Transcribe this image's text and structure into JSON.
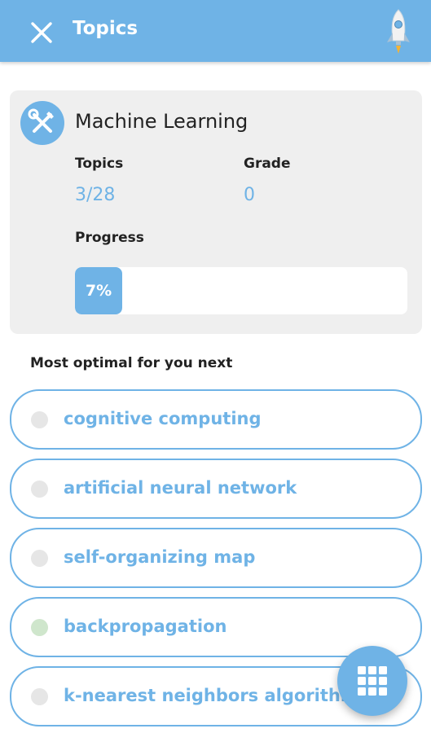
{
  "header": {
    "title": "Topics"
  },
  "course": {
    "title": "Machine Learning",
    "topics_label": "Topics",
    "topics_value": "3/28",
    "grade_label": "Grade",
    "grade_value": "0",
    "progress_label": "Progress",
    "progress_text": "7%",
    "progress_value": 0.07
  },
  "suggestions": {
    "heading": "Most optimal for you next",
    "items": [
      {
        "label": "cognitive computing",
        "status": "not-started"
      },
      {
        "label": "artificial neural network",
        "status": "not-started"
      },
      {
        "label": "self-organizing map",
        "status": "not-started"
      },
      {
        "label": "backpropagation",
        "status": "done"
      },
      {
        "label": "k-nearest neighbors algorithm",
        "status": "not-started"
      }
    ]
  },
  "icons": {
    "close": "close-icon",
    "rocket": "rocket-icon",
    "course": "tools-icon",
    "fab": "grid-icon"
  },
  "colors": {
    "accent": "#6fb3e6",
    "done_dot": "#cfe6cc",
    "pending_dot": "#e6e6e6"
  }
}
